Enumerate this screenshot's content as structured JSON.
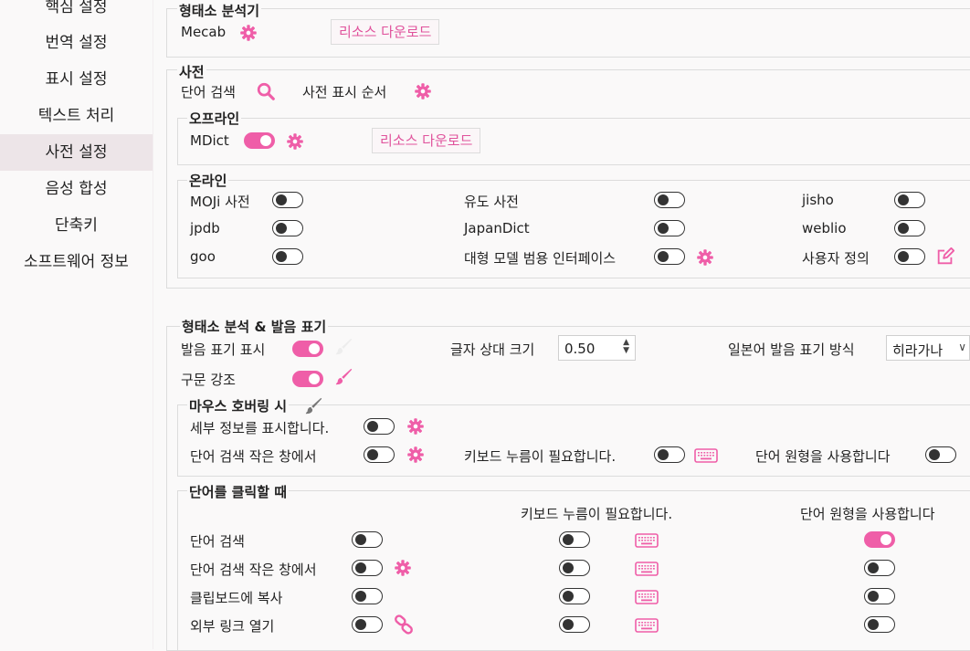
{
  "sidebar": {
    "items": [
      {
        "label": "핵심 설정"
      },
      {
        "label": "번역 설정"
      },
      {
        "label": "표시 설정"
      },
      {
        "label": "텍스트 처리"
      },
      {
        "label": "사전 설정"
      },
      {
        "label": "음성 합성"
      },
      {
        "label": "단축키"
      },
      {
        "label": "소프트웨어 정보"
      }
    ],
    "active_index": 4
  },
  "morph": {
    "title": "형태소 분석기",
    "engine": "Mecab",
    "download_label": "리소스 다운로드"
  },
  "dict": {
    "title": "사전",
    "search_label": "단어 검색",
    "order_label": "사전 표시 순서",
    "offline": {
      "title": "오프라인",
      "mdict_label": "MDict",
      "mdict_on": true,
      "download_label": "리소스 다운로드"
    },
    "online": {
      "title": "온라인",
      "items": [
        {
          "label": "MOJi 사전",
          "on": false
        },
        {
          "label": "유도 사전",
          "on": false
        },
        {
          "label": "jisho",
          "on": false
        },
        {
          "label": "jpdb",
          "on": false
        },
        {
          "label": "JapanDict",
          "on": false
        },
        {
          "label": "weblio",
          "on": false
        },
        {
          "label": "goo",
          "on": false
        },
        {
          "label": "대형 모델 범용 인터페이스",
          "on": false
        },
        {
          "label": "사용자 정의",
          "on": false
        }
      ]
    }
  },
  "pron": {
    "title": "형태소 분석 & 발음 표기",
    "show_label": "발음 표기 표시",
    "show_on": true,
    "size_label": "글자 상대 크기",
    "size_value": "0.50",
    "method_label": "일본어 발음 표기 방식",
    "method_value": "히라가나",
    "syntax_label": "구문 강조",
    "syntax_on": true
  },
  "hover": {
    "title": "마우스 호버링 시",
    "detail_label": "세부 정보를 표시합니다.",
    "detail_on": false,
    "small_label": "단어 검색 작은 창에서",
    "small_on": false,
    "keyboard_label": "키보드 누름이 필요합니다.",
    "keyboard_on": false,
    "base_label": "단어 원형을 사용합니다",
    "base_on": false
  },
  "click": {
    "title": "단어를 클릭할 때",
    "col_keyboard": "키보드 누름이 필요합니다.",
    "col_base": "단어 원형을 사용합니다",
    "rows": [
      {
        "label": "단어 검색",
        "on": false,
        "kb": false,
        "base": true
      },
      {
        "label": "단어 검색 작은 창에서",
        "on": false,
        "kb": false,
        "base": false
      },
      {
        "label": "클립보드에 복사",
        "on": false,
        "kb": false,
        "base": false
      },
      {
        "label": "외부 링크 열기",
        "on": false,
        "kb": false,
        "base": false
      }
    ]
  },
  "colors": {
    "accent": "#ef5ea8",
    "active_bg": "#ede5e8"
  },
  "icons": [
    "gear-icon",
    "search-icon",
    "edit-icon",
    "brush-icon",
    "keyboard-icon",
    "link-icon",
    "spin-arrows-icon",
    "chevron-down-icon"
  ]
}
